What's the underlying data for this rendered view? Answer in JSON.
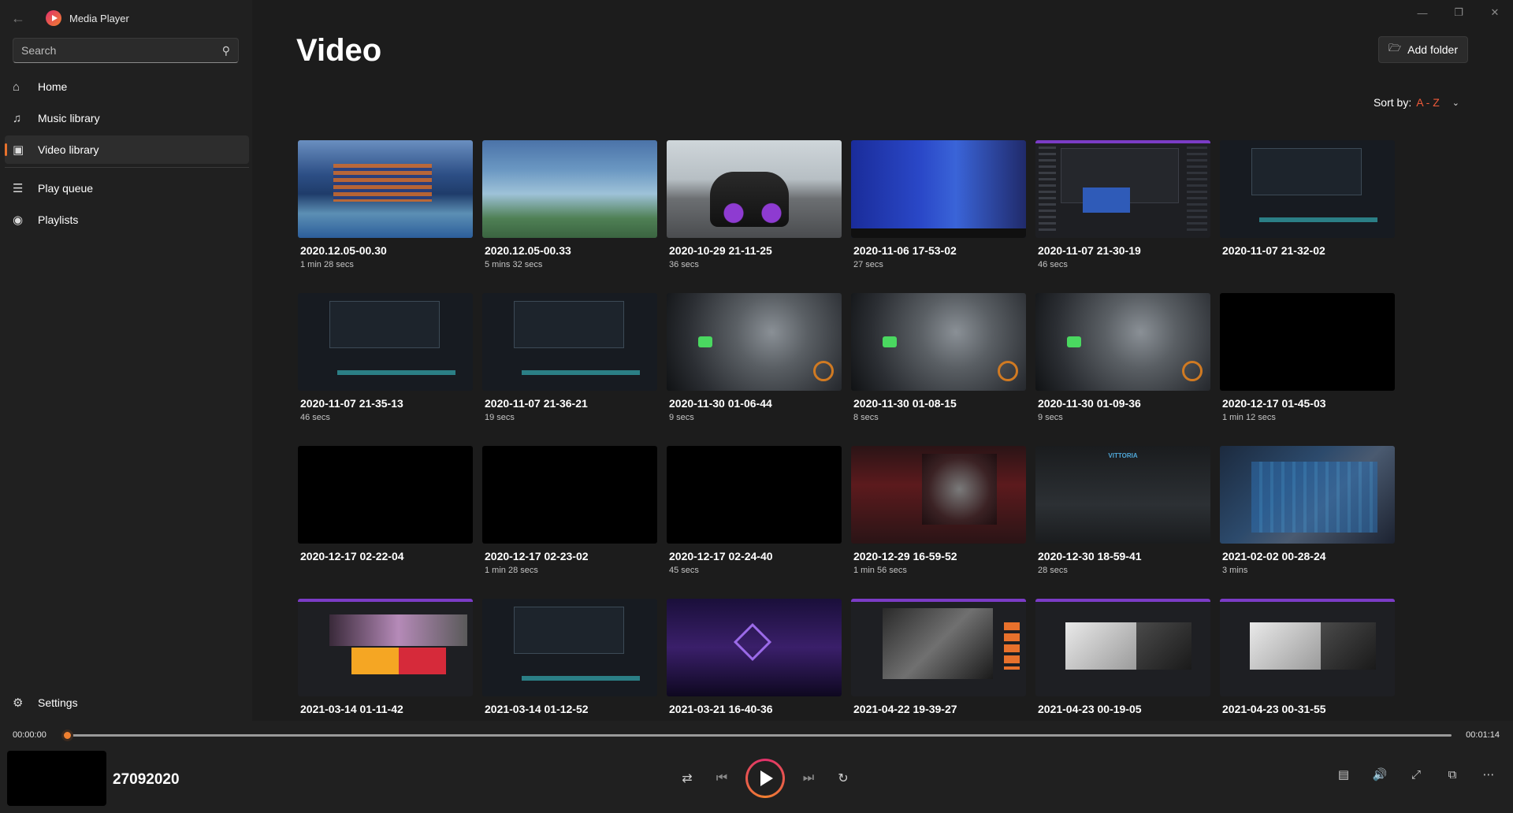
{
  "app": {
    "title": "Media Player"
  },
  "search": {
    "placeholder": "Search"
  },
  "nav": {
    "items": [
      {
        "label": "Home",
        "icon": "home-icon"
      },
      {
        "label": "Music library",
        "icon": "music-icon"
      },
      {
        "label": "Video library",
        "icon": "video-icon",
        "active": true
      },
      {
        "label": "Play queue",
        "icon": "queue-icon"
      },
      {
        "label": "Playlists",
        "icon": "playlist-icon"
      }
    ],
    "settings": "Settings"
  },
  "main": {
    "title": "Video",
    "add_folder": "Add folder",
    "sort_label": "Sort by:",
    "sort_value": "A - Z"
  },
  "videos": [
    {
      "title": "2020.12.05-00.30",
      "duration": "1 min 28 secs"
    },
    {
      "title": "2020.12.05-00.33",
      "duration": "5 mins 32 secs"
    },
    {
      "title": "2020-10-29 21-11-25",
      "duration": "36 secs"
    },
    {
      "title": "2020-11-06 17-53-02",
      "duration": "27 secs"
    },
    {
      "title": "2020-11-07 21-30-19",
      "duration": "46 secs"
    },
    {
      "title": "2020-11-07 21-32-02",
      "duration": ""
    },
    {
      "title": "2020-11-07 21-35-13",
      "duration": "46 secs"
    },
    {
      "title": "2020-11-07 21-36-21",
      "duration": "19 secs"
    },
    {
      "title": "2020-11-30 01-06-44",
      "duration": "9 secs"
    },
    {
      "title": "2020-11-30 01-08-15",
      "duration": "8 secs"
    },
    {
      "title": "2020-11-30 01-09-36",
      "duration": "9 secs"
    },
    {
      "title": "2020-12-17 01-45-03",
      "duration": "1 min 12 secs"
    },
    {
      "title": "2020-12-17 02-22-04",
      "duration": ""
    },
    {
      "title": "2020-12-17 02-23-02",
      "duration": "1 min 28 secs"
    },
    {
      "title": "2020-12-17 02-24-40",
      "duration": "45 secs"
    },
    {
      "title": "2020-12-29 16-59-52",
      "duration": "1 min 56 secs"
    },
    {
      "title": "2020-12-30 18-59-41",
      "duration": "28 secs"
    },
    {
      "title": "2021-02-02 00-28-24",
      "duration": "3 mins"
    },
    {
      "title": "2021-03-14 01-11-42",
      "duration": ""
    },
    {
      "title": "2021-03-14 01-12-52",
      "duration": ""
    },
    {
      "title": "2021-03-21 16-40-36",
      "duration": ""
    },
    {
      "title": "2021-04-22 19-39-27",
      "duration": ""
    },
    {
      "title": "2021-04-23 00-19-05",
      "duration": ""
    },
    {
      "title": "2021-04-23 00-31-55",
      "duration": ""
    }
  ],
  "thumbnail_labels": {
    "vittoria": "VITTORIA"
  },
  "player": {
    "current_time": "00:00:00",
    "total_time": "00:01:14",
    "progress_fraction": 0,
    "now_playing": "27092020"
  },
  "colors": {
    "accent": "#e8712c",
    "sort_accent": "#f05a3a"
  }
}
